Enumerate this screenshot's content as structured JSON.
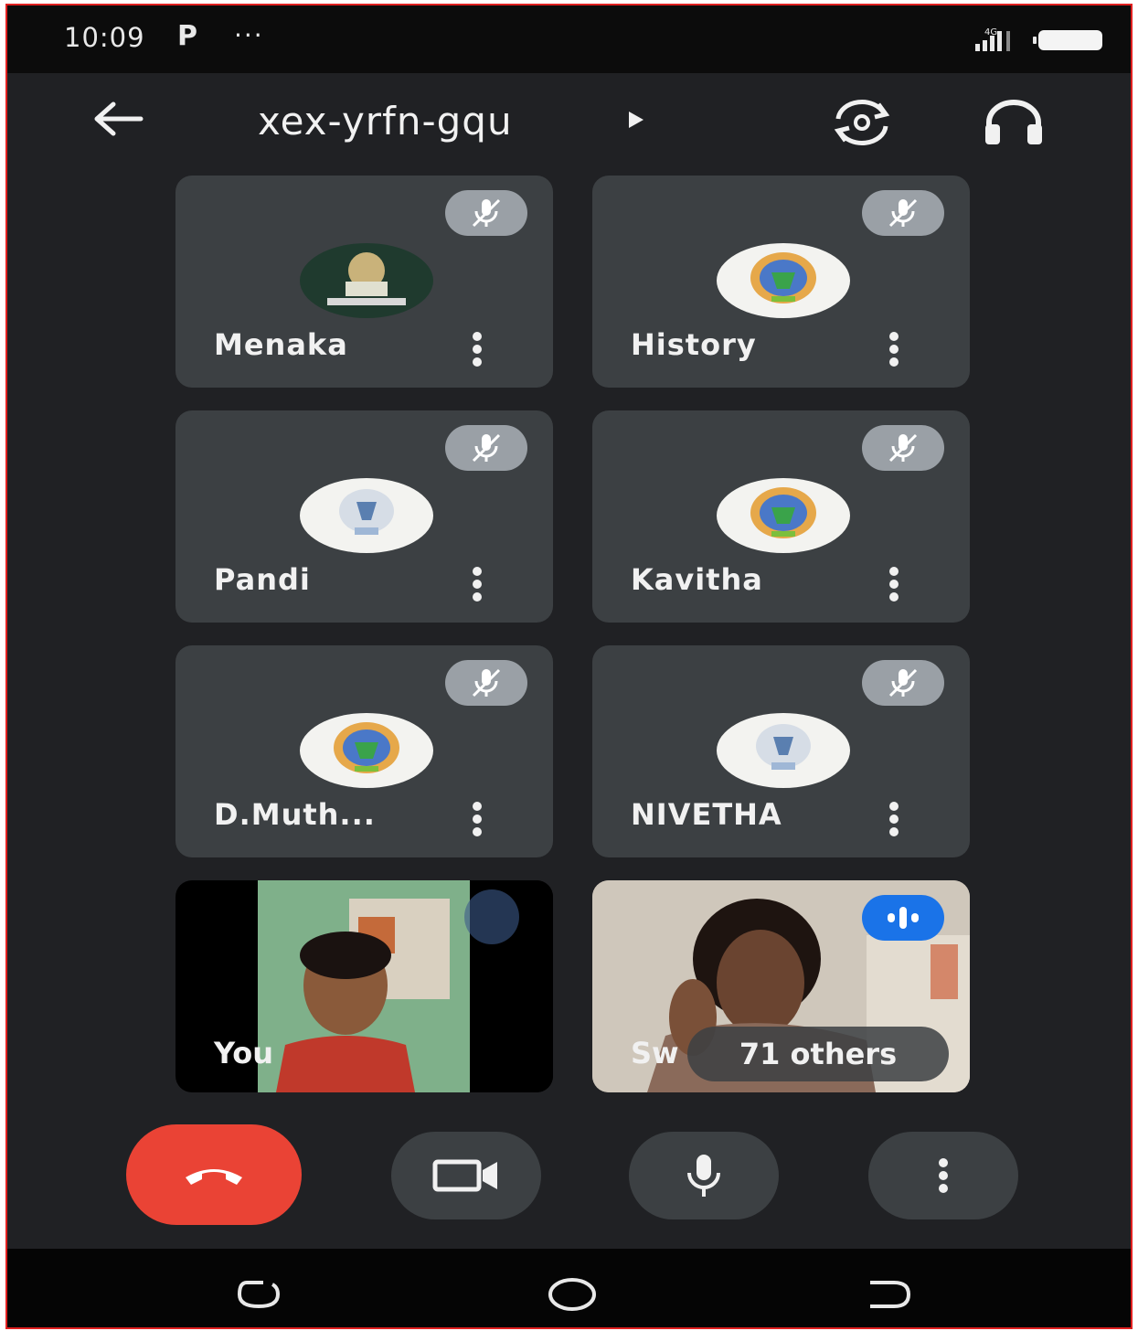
{
  "status_bar": {
    "time": "10:09",
    "notification_letter": "P",
    "more": "···",
    "network": "4G"
  },
  "header": {
    "meeting_code": "xex-yrfn-gqu"
  },
  "participants": [
    {
      "name": "Menaka"
    },
    {
      "name": "History"
    },
    {
      "name": "Pandi"
    },
    {
      "name": "Kavitha"
    },
    {
      "name": "D.Muth..."
    },
    {
      "name": "NIVETHA"
    }
  ],
  "video_tiles": {
    "self_label": "You",
    "speaker_label": "Sw",
    "others_label": "71 others"
  },
  "colors": {
    "end_call": "#ea4335",
    "tile_bg": "#3c4043",
    "speaking_badge": "#1a73e8"
  }
}
